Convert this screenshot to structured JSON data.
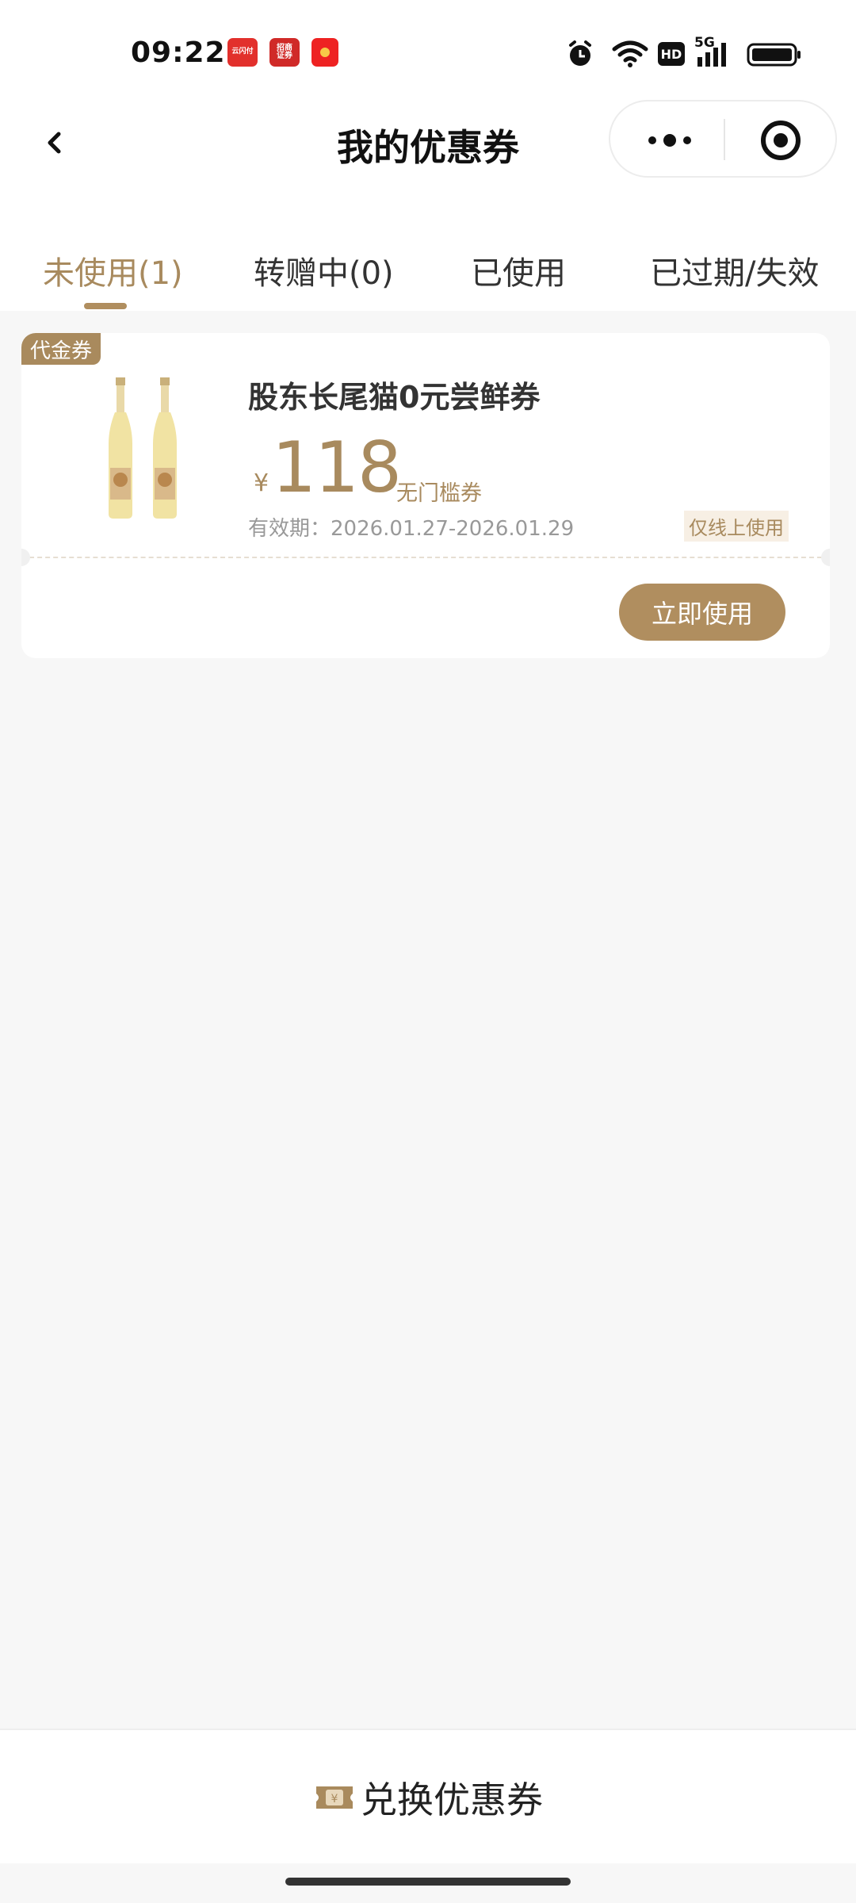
{
  "status_bar": {
    "time": "09:22",
    "app_icons": [
      {
        "name": "yunshanfu-icon",
        "text": "云闪付"
      },
      {
        "name": "cmb-securities-icon",
        "text": "招商证券"
      },
      {
        "name": "red-packet-icon",
        "text": ""
      }
    ],
    "indicators": [
      "alarm-icon",
      "wifi-icon",
      "hd-icon",
      "5g-signal-icon",
      "battery-icon"
    ],
    "hd_text": "HD",
    "network_text": "5G"
  },
  "header": {
    "title": "我的优惠券",
    "back_icon": "chevron-left-icon",
    "more_icon": "more-dots-icon",
    "close_icon": "target-icon"
  },
  "tabs": [
    {
      "label": "未使用(1)",
      "active": true
    },
    {
      "label": "转赠中(0)",
      "active": false
    },
    {
      "label": "已使用",
      "active": false
    },
    {
      "label": "已过期/失效",
      "active": false
    }
  ],
  "coupons": [
    {
      "badge": "代金券",
      "name": "股东长尾猫0元尝鲜券",
      "currency": "¥",
      "amount": "118",
      "threshold": "无门槛券",
      "validity": "有效期：2026.01.27-2026.01.29",
      "channel": "仅线上使用",
      "action": "立即使用"
    }
  ],
  "footer": {
    "redeem_label": "兑换优惠券",
    "redeem_icon": "ticket-yuan-icon"
  },
  "colors": {
    "accent": "#b08e5f",
    "accent_text": "#a88a5e",
    "background": "#f7f7f7"
  }
}
